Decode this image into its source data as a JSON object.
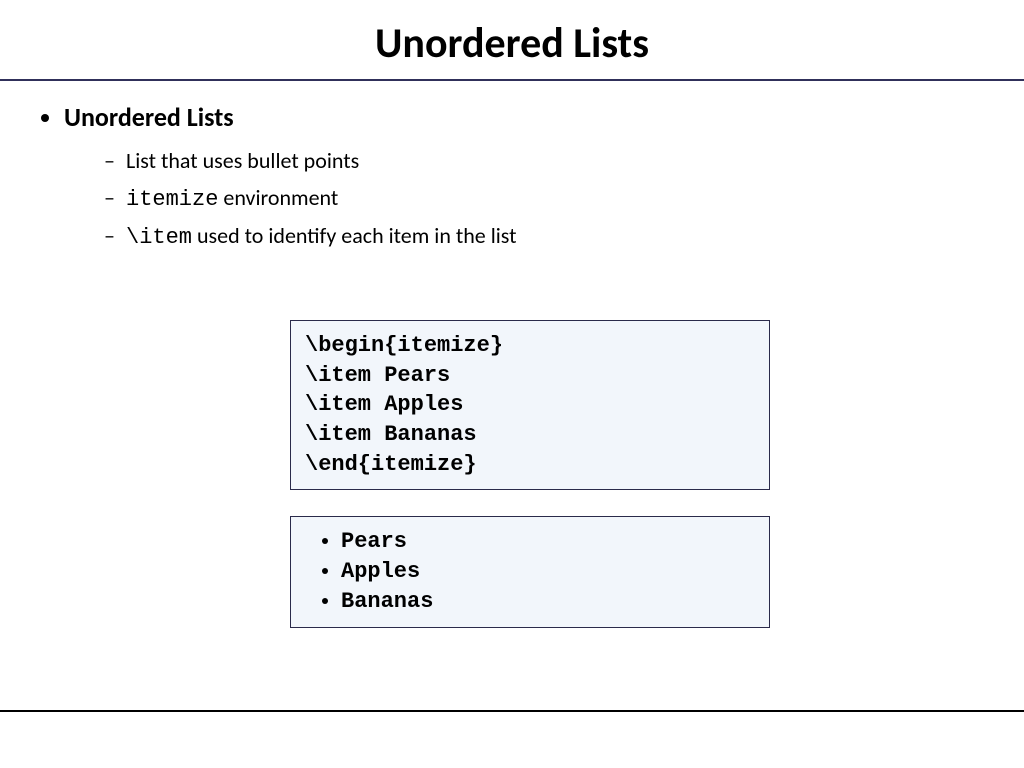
{
  "title": "Unordered Lists",
  "bullet": {
    "heading": "Unordered Lists",
    "sub": [
      {
        "text": "List that uses bullet points"
      },
      {
        "code": "itemize",
        "text_after": " environment"
      },
      {
        "code": "\\item",
        "text_after": " used to identify each item in the list"
      }
    ]
  },
  "code": {
    "lines": [
      "\\begin{itemize}",
      "\\item Pears",
      "\\item Apples",
      "\\item Bananas",
      "\\end{itemize}"
    ]
  },
  "output": {
    "items": [
      "Pears",
      "Apples",
      "Bananas"
    ]
  }
}
